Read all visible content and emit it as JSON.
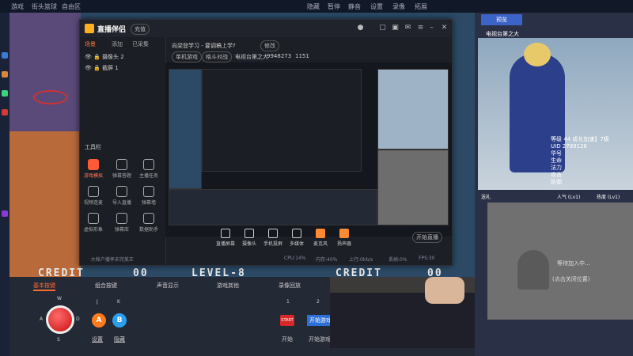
{
  "topbar": {
    "left1": "游戏",
    "left2": "街头篮球",
    "left3": "自由区",
    "right_items": [
      "隐藏",
      "暂停",
      "静音",
      "设置",
      "录像",
      "拓展"
    ]
  },
  "obs": {
    "app_title": "直播伴侣",
    "badge": "充值",
    "stream_title": "向梁登学习 - 要调稿上学?",
    "modify": "修改",
    "tag1": "单机游戏",
    "tag2": "格斗对战",
    "room_label": "电视台第之大",
    "room_id": "9948273",
    "count": "1151",
    "left_tabs": [
      "场景",
      "添加",
      "已采集"
    ],
    "scenes": [
      "摄像头 2",
      "截屏 1"
    ],
    "tools_header": "工具栏",
    "tools": [
      {
        "label": "游戏模拟",
        "hot": true
      },
      {
        "label": "弹幕答题",
        "hot": false
      },
      {
        "label": "主播任务",
        "hot": false
      },
      {
        "label": "视频连麦",
        "hot": false
      },
      {
        "label": "导入直播",
        "hot": false
      },
      {
        "label": "弹幕墙",
        "hot": false
      },
      {
        "label": "虚拟形象",
        "hot": false
      },
      {
        "label": "弹幕库",
        "hot": false
      },
      {
        "label": "数据助手",
        "hot": false
      }
    ],
    "bottom_buttons": [
      "直播屏幕",
      "摄像头",
      "手机投屏",
      "多媒体",
      "麦克风",
      "扬声器"
    ],
    "start_live": "开始直播",
    "status_items": [
      "·大帐户播率未完美正",
      "CPU:14%",
      "内存:40%",
      "上行:0kb/s",
      "丢帧:0%",
      "FPS:30"
    ]
  },
  "game": {
    "credit_left": "CREDIT",
    "credit_left_val": "00",
    "level": "LEVEL-8",
    "credit_right": "CREDIT",
    "credit_right_val": "00"
  },
  "controls": {
    "tabs": [
      "基本按键",
      "组合按键",
      "声音显示",
      "游戏其他",
      "录像回放"
    ],
    "dir_keys": {
      "up": "W",
      "left": "A",
      "right": "D",
      "down": "S"
    },
    "key_j": "J",
    "key_k": "K",
    "btn_a": "A",
    "btn_b": "B",
    "link_setting": "设置",
    "link_hide": "隐藏",
    "rec_num1": "1",
    "rec_num2": "2",
    "rec_btn": "START",
    "rec_label": "开始",
    "blue1": "开始游戏",
    "blue2": "开始游戏"
  },
  "right": {
    "top_button": "预览",
    "title": "电视台第之大",
    "stats": [
      "等级 44  成长加速】7级",
      "UID  2789126",
      "华号",
      "生命",
      "法力",
      "攻击",
      "防御",
      "主题",
      "表现",
      "人气(Lv1)  热度 (Lv1)"
    ],
    "gift_left": "送礼",
    "gift_mid": "人气 (Lv1)",
    "gift_right": "热度 (Lv1)",
    "waiting": "等待加入中...",
    "click_hint": "(点击关闭位置)"
  }
}
